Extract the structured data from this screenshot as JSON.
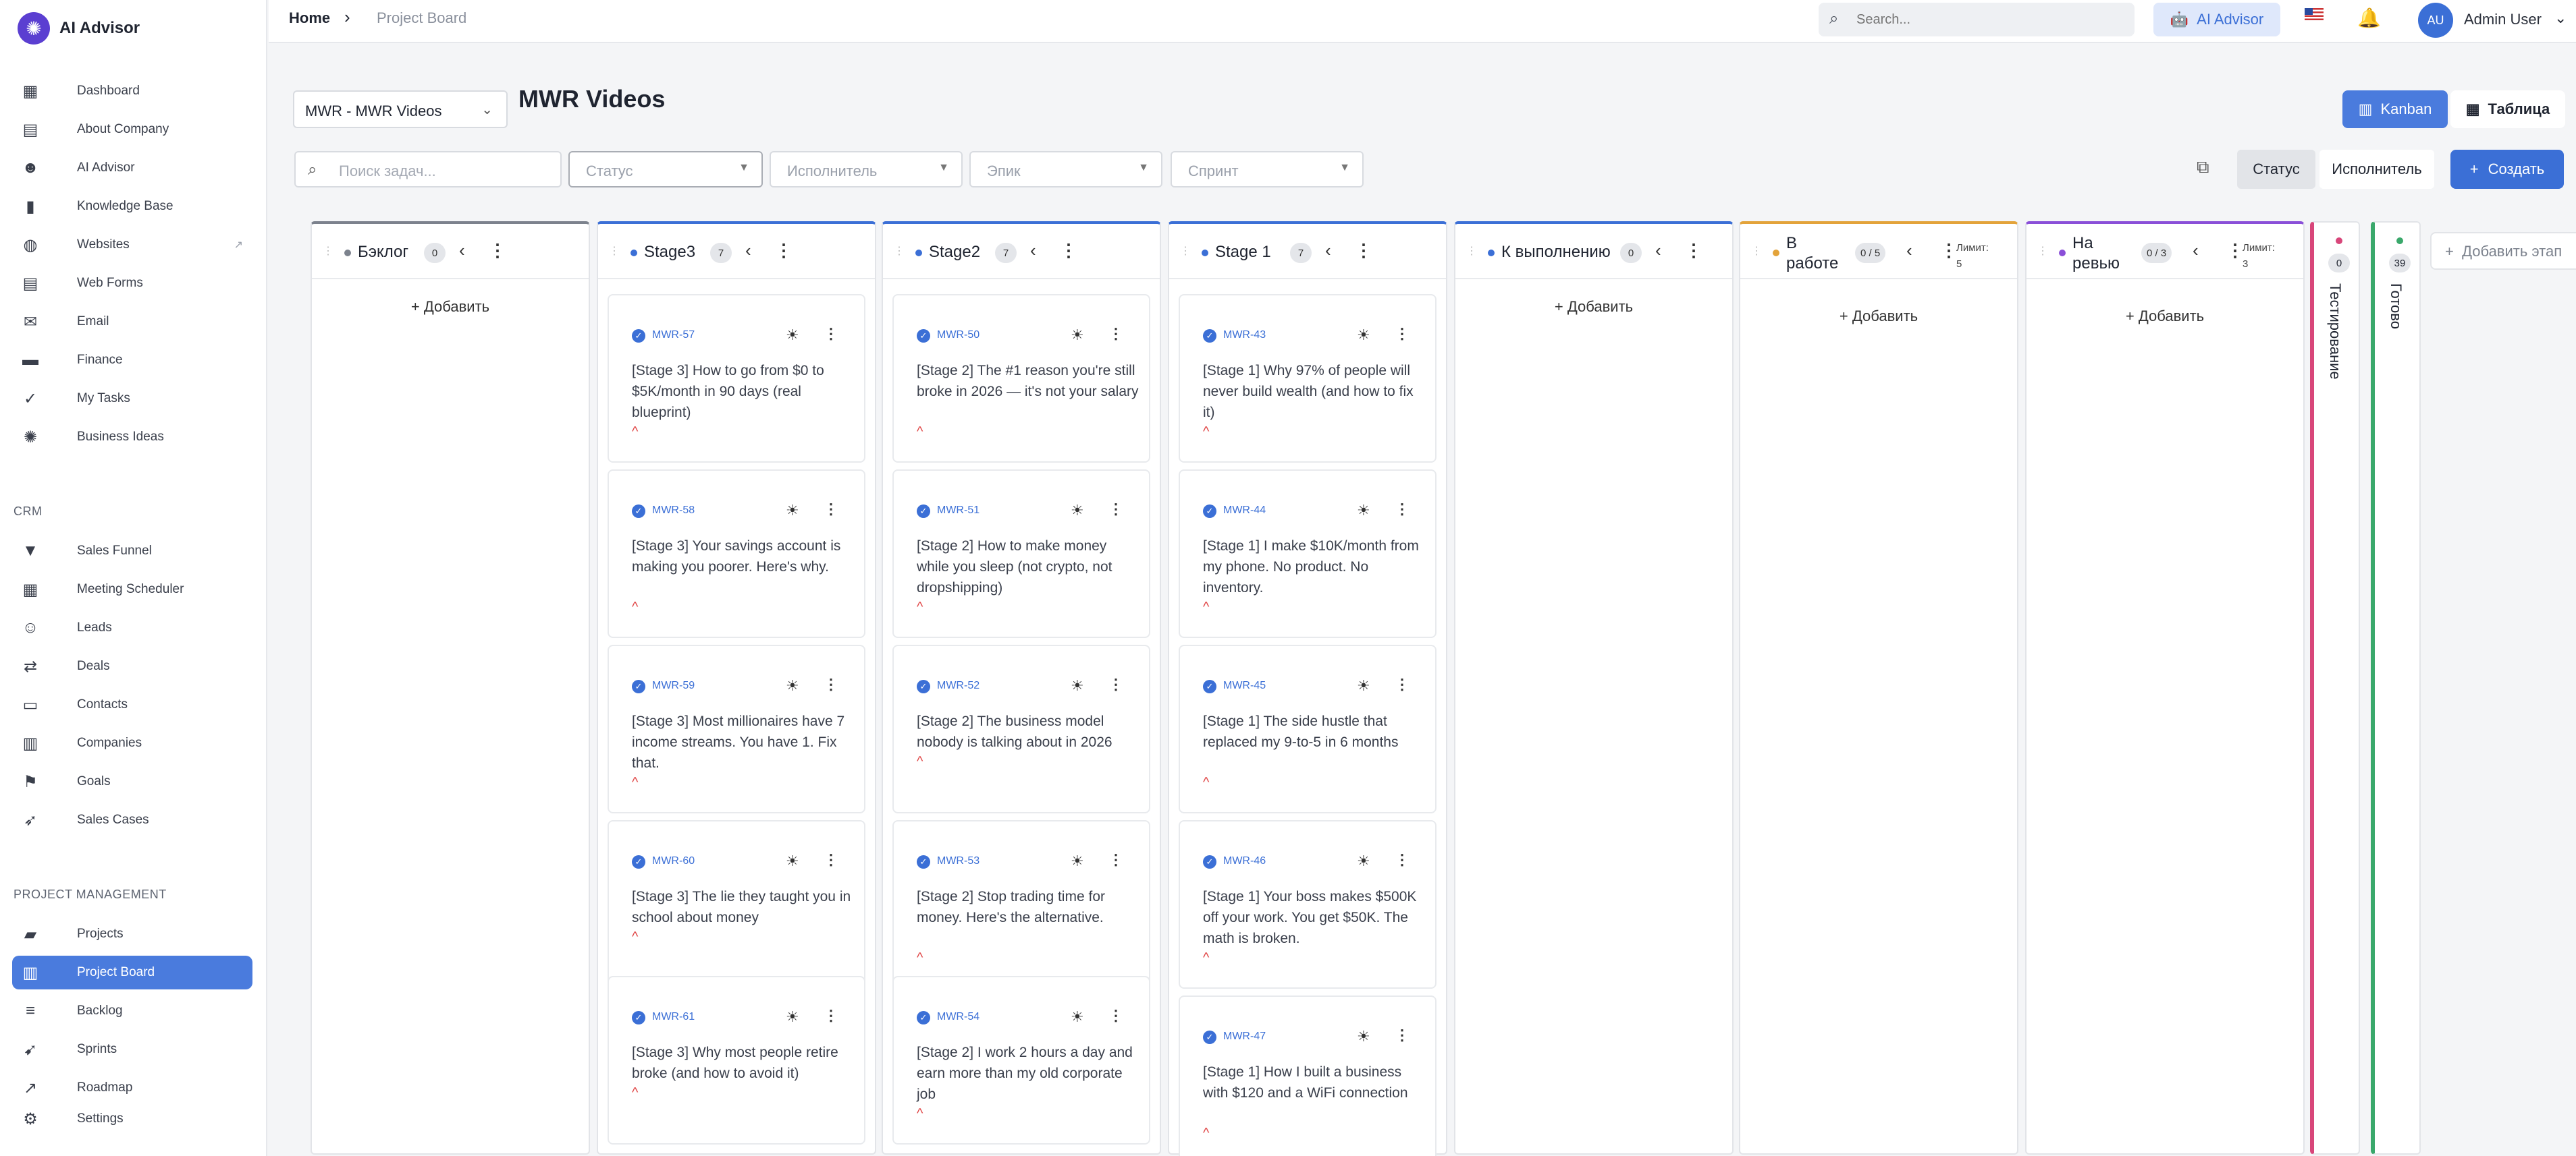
{
  "app": {
    "name": "AI Advisor"
  },
  "sidebar": {
    "main_items": [
      {
        "label": "Dashboard",
        "icon": "dashboard-icon"
      },
      {
        "label": "About Company",
        "icon": "building-icon"
      },
      {
        "label": "AI Advisor",
        "icon": "robot-icon"
      },
      {
        "label": "Knowledge Base",
        "icon": "book-icon"
      },
      {
        "label": "Websites",
        "icon": "globe-icon"
      },
      {
        "label": "Web Forms",
        "icon": "form-icon"
      },
      {
        "label": "Email",
        "icon": "mail-icon"
      },
      {
        "label": "Finance",
        "icon": "wallet-icon"
      },
      {
        "label": "My Tasks",
        "icon": "check-circle-icon"
      },
      {
        "label": "Business Ideas",
        "icon": "bulb-icon"
      }
    ],
    "crm_label": "CRM",
    "crm_items": [
      {
        "label": "Sales Funnel",
        "icon": "funnel-icon"
      },
      {
        "label": "Meeting Scheduler",
        "icon": "calendar-icon"
      },
      {
        "label": "Leads",
        "icon": "person-add-icon"
      },
      {
        "label": "Deals",
        "icon": "handshake-icon"
      },
      {
        "label": "Contacts",
        "icon": "contact-card-icon"
      },
      {
        "label": "Companies",
        "icon": "office-icon"
      },
      {
        "label": "Goals",
        "icon": "flag-icon"
      },
      {
        "label": "Sales Cases",
        "icon": "rocket-icon"
      }
    ],
    "pm_label": "PROJECT MANAGEMENT",
    "pm_items": [
      {
        "label": "Projects",
        "icon": "folders-icon"
      },
      {
        "label": "Project Board",
        "icon": "board-icon",
        "active": true
      },
      {
        "label": "Backlog",
        "icon": "list-icon"
      },
      {
        "label": "Sprints",
        "icon": "runner-icon"
      },
      {
        "label": "Roadmap",
        "icon": "trend-icon"
      }
    ],
    "settings_label": "Settings"
  },
  "header": {
    "home": "Home",
    "separator": "›",
    "current": "Project Board",
    "search_placeholder": "Search...",
    "ai_button": "AI Advisor",
    "avatar_initials": "AU",
    "user_name": "Admin User"
  },
  "toolbar": {
    "project_select": "MWR - MWR Videos",
    "board_title": "MWR Videos",
    "view_kanban": "Kanban",
    "view_table": "Таблица",
    "task_search_placeholder": "Поиск задач...",
    "filters": [
      "Статус",
      "Исполнитель",
      "Эпик",
      "Спринт"
    ],
    "group_status": "Статус",
    "group_assignee": "Исполнитель",
    "create": "Создать"
  },
  "columns": [
    {
      "name": "Бэклог",
      "count": "0",
      "color": "#7c828d",
      "add": "Добавить",
      "cards": []
    },
    {
      "name": "Stage3",
      "count": "7",
      "color": "#3b6fd6",
      "cards": [
        {
          "id": "MWR-57",
          "title": "[Stage 3] How to go from $0 to $5K/month in 90 days (real blueprint)"
        },
        {
          "id": "MWR-58",
          "title": "[Stage 3] Your savings account is making you poorer. Here's why."
        },
        {
          "id": "MWR-59",
          "title": "[Stage 3] Most millionaires have 7 income streams. You have 1. Fix that."
        },
        {
          "id": "MWR-60",
          "title": "[Stage 3] The lie they taught you in school about money"
        },
        {
          "id": "MWR-61",
          "title": "[Stage 3] Why most people retire broke (and how to avoid it)"
        }
      ]
    },
    {
      "name": "Stage2",
      "count": "7",
      "color": "#3b6fd6",
      "cards": [
        {
          "id": "MWR-50",
          "title": "[Stage 2] The #1 reason you're still broke in 2026 — it's not your salary"
        },
        {
          "id": "MWR-51",
          "title": "[Stage 2] How to make money while you sleep (not crypto, not dropshipping)"
        },
        {
          "id": "MWR-52",
          "title": "[Stage 2] The business model nobody is talking about in 2026"
        },
        {
          "id": "MWR-53",
          "title": "[Stage 2] Stop trading time for money. Here's the alternative."
        },
        {
          "id": "MWR-54",
          "title": "[Stage 2] I work 2 hours a day and earn more than my old corporate job"
        }
      ]
    },
    {
      "name": "Stage 1",
      "count": "7",
      "color": "#3b6fd6",
      "cards": [
        {
          "id": "MWR-43",
          "title": "[Stage 1] Why 97% of people will never build wealth (and how to fix it)"
        },
        {
          "id": "MWR-44",
          "title": "[Stage 1] I make $10K/month from my phone. No product. No inventory."
        },
        {
          "id": "MWR-45",
          "title": "[Stage 1] The side hustle that replaced my 9-to-5 in 6 months"
        },
        {
          "id": "MWR-46",
          "title": "[Stage 1] Your boss makes $500K off your work. You get $50K. The math is broken."
        },
        {
          "id": "MWR-47",
          "title": "[Stage 1] How I built a business with $120 and a WiFi connection"
        }
      ]
    },
    {
      "name": "К выполнению",
      "count": "0",
      "color": "#3b6fd6",
      "add": "Добавить",
      "cards": []
    },
    {
      "name": "В работе",
      "count": "0 / 5",
      "color": "#e3a33a",
      "limit_label": "Лимит:",
      "limit_value": "5",
      "add": "Добавить",
      "cards": []
    },
    {
      "name": "На ревью",
      "count": "0 / 3",
      "color": "#8a4fd8",
      "limit_label": "Лимит:",
      "limit_value": "3",
      "add": "Добавить",
      "cards": []
    }
  ],
  "collapsed_columns": [
    {
      "name": "Тестирование",
      "count": "0",
      "color": "#d8467a"
    },
    {
      "name": "Готово",
      "count": "39",
      "color": "#3aa86b"
    }
  ],
  "add_stage": "Добавить этап",
  "icons": {
    "plus": "+",
    "priority": "^"
  }
}
